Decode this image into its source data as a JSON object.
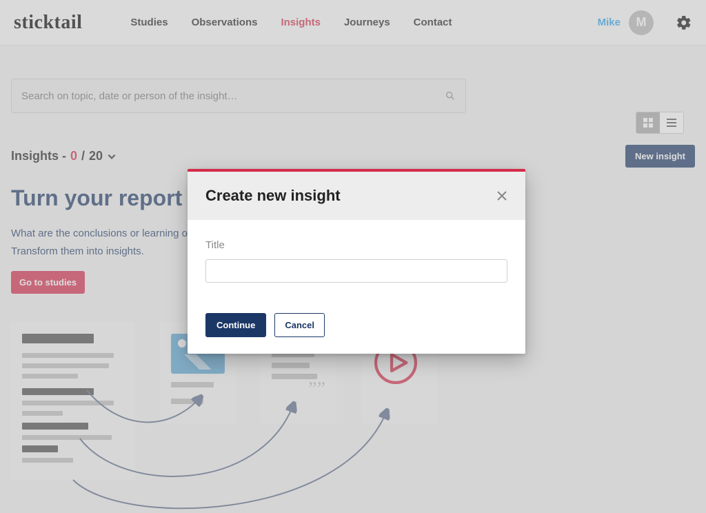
{
  "brand": "sticktail",
  "nav": {
    "items": [
      "Studies",
      "Observations",
      "Insights",
      "Journeys",
      "Contact"
    ],
    "active_index": 2
  },
  "user": {
    "name": "Mike",
    "initial": "M"
  },
  "search": {
    "placeholder": "Search on topic, date or person of the insight…"
  },
  "insights": {
    "label_prefix": "Insights - ",
    "current": "0",
    "sep": " /",
    "total": "20"
  },
  "buttons": {
    "new_insight": "New insight",
    "go_to_studies": "Go to studies"
  },
  "hero": {
    "title": "Turn your report into insights",
    "desc": "What are the conclusions or learning of your studies, and what do you want to share with your organization? Transform them into insights."
  },
  "modal": {
    "title": "Create new insight",
    "field_label": "Title",
    "continue": "Continue",
    "cancel": "Cancel"
  }
}
